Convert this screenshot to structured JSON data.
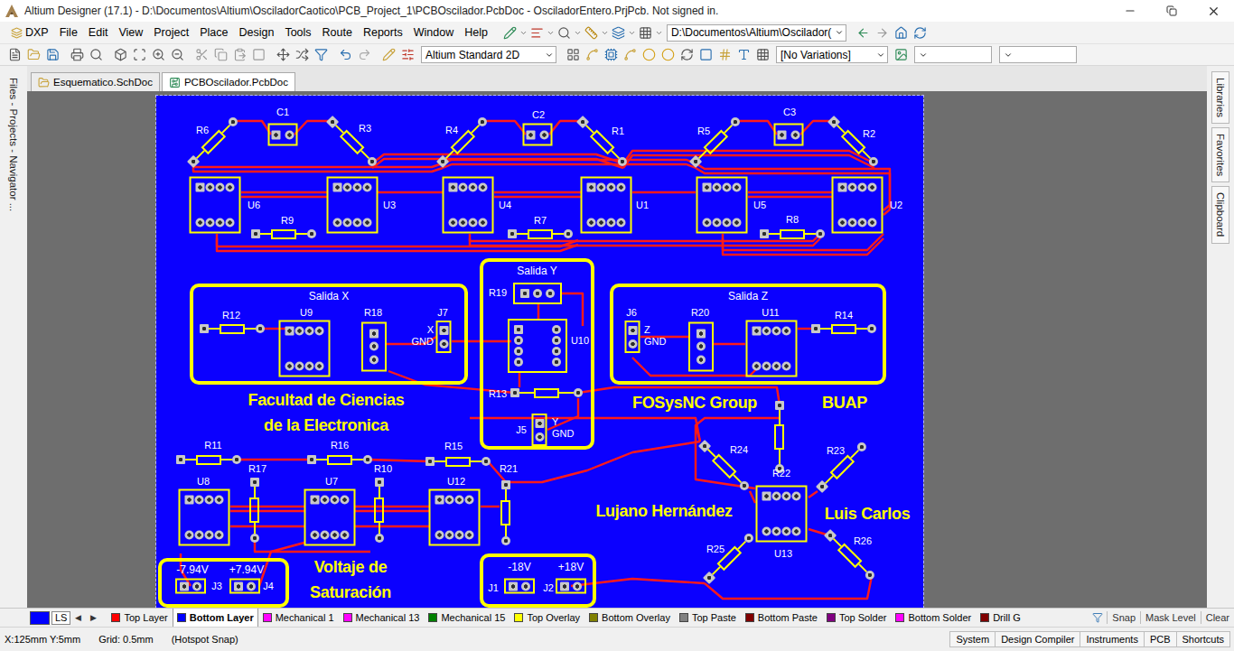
{
  "window": {
    "title": "Altium Designer (17.1) - D:\\Documentos\\Altium\\OsciladorCaotico\\PCB_Project_1\\PCBOscilador.PcbDoc - OsciladorEntero.PrjPcb. Not signed in."
  },
  "menu": [
    "DXP",
    "File",
    "Edit",
    "View",
    "Project",
    "Place",
    "Design",
    "Tools",
    "Route",
    "Reports",
    "Window",
    "Help"
  ],
  "toolbar": {
    "path": "D:\\Documentos\\Altium\\Oscilador(",
    "view_mode": "Altium Standard 2D",
    "variations": "[No Variations]"
  },
  "side_panels": {
    "left": [
      "Files - Projects - Navigator ..."
    ],
    "right": [
      "Libraries",
      "Favorites",
      "Clipboard"
    ]
  },
  "documents": [
    {
      "label": "Esquematico.SchDoc",
      "kind": "schematic",
      "selected": false
    },
    {
      "label": "PCBOscilador.PcbDoc",
      "kind": "pcb",
      "selected": true
    }
  ],
  "board": {
    "sections": [
      {
        "kind": "titled",
        "title": "Salida X"
      },
      {
        "kind": "titled",
        "title": "Salida Y"
      },
      {
        "kind": "titled",
        "title": "Salida Z"
      },
      {
        "kind": "frame"
      },
      {
        "kind": "frame"
      }
    ],
    "texts": [
      {
        "text": "Facultad de Ciencias",
        "kind": "title"
      },
      {
        "text": "de la Electronica",
        "kind": "title"
      },
      {
        "text": "FOSysNC Group",
        "kind": "title"
      },
      {
        "text": "BUAP",
        "kind": "title"
      },
      {
        "text": "Lujano Hernández",
        "kind": "title"
      },
      {
        "text": "Luis Carlos",
        "kind": "title"
      },
      {
        "text": "Voltaje de",
        "kind": "title"
      },
      {
        "text": "Saturación",
        "kind": "title"
      },
      {
        "text": "-7.94V",
        "kind": "note"
      },
      {
        "text": "+7.94V",
        "kind": "note"
      },
      {
        "text": "-18V",
        "kind": "note"
      },
      {
        "text": "+18V",
        "kind": "note"
      }
    ],
    "components": [
      {
        "designator": "R6",
        "kind": "resistor"
      },
      {
        "designator": "C1",
        "kind": "capacitor"
      },
      {
        "designator": "R3",
        "kind": "resistor"
      },
      {
        "designator": "R4",
        "kind": "resistor"
      },
      {
        "designator": "C2",
        "kind": "capacitor"
      },
      {
        "designator": "R1",
        "kind": "resistor"
      },
      {
        "designator": "R5",
        "kind": "resistor"
      },
      {
        "designator": "C3",
        "kind": "capacitor"
      },
      {
        "designator": "R2",
        "kind": "resistor"
      },
      {
        "designator": "U6",
        "kind": "ic"
      },
      {
        "designator": "U3",
        "kind": "ic"
      },
      {
        "designator": "U4",
        "kind": "ic"
      },
      {
        "designator": "U1",
        "kind": "ic"
      },
      {
        "designator": "U5",
        "kind": "ic"
      },
      {
        "designator": "U2",
        "kind": "ic"
      },
      {
        "designator": "R9",
        "kind": "resistor"
      },
      {
        "designator": "R7",
        "kind": "resistor"
      },
      {
        "designator": "R8",
        "kind": "resistor"
      },
      {
        "designator": "R12",
        "kind": "resistor"
      },
      {
        "designator": "U9",
        "kind": "ic"
      },
      {
        "designator": "R18",
        "kind": "pot"
      },
      {
        "designator": "J7",
        "kind": "connector",
        "pins": [
          "X",
          "GND"
        ]
      },
      {
        "designator": "R19",
        "kind": "pot"
      },
      {
        "designator": "U10",
        "kind": "ic"
      },
      {
        "designator": "R13",
        "kind": "resistor"
      },
      {
        "designator": "J5",
        "kind": "connector",
        "pins": [
          "Y",
          "GND"
        ]
      },
      {
        "designator": "J6",
        "kind": "connector",
        "pins": [
          "Z",
          "GND"
        ]
      },
      {
        "designator": "R20",
        "kind": "pot"
      },
      {
        "designator": "U11",
        "kind": "ic"
      },
      {
        "designator": "R14",
        "kind": "resistor"
      },
      {
        "designator": "R11",
        "kind": "resistor"
      },
      {
        "designator": "R16",
        "kind": "resistor"
      },
      {
        "designator": "R15",
        "kind": "resistor"
      },
      {
        "designator": "R21",
        "kind": "resistor"
      },
      {
        "designator": "U8",
        "kind": "ic"
      },
      {
        "designator": "R17",
        "kind": "resistor"
      },
      {
        "designator": "U7",
        "kind": "ic"
      },
      {
        "designator": "R10",
        "kind": "resistor"
      },
      {
        "designator": "U12",
        "kind": "ic"
      },
      {
        "designator": "R22",
        "kind": "resistor"
      },
      {
        "designator": "R24",
        "kind": "resistor"
      },
      {
        "designator": "R23",
        "kind": "resistor"
      },
      {
        "designator": "U13",
        "kind": "ic"
      },
      {
        "designator": "R25",
        "kind": "resistor"
      },
      {
        "designator": "R26",
        "kind": "resistor"
      },
      {
        "designator": "J3",
        "kind": "connector"
      },
      {
        "designator": "J4",
        "kind": "connector"
      },
      {
        "designator": "J1",
        "kind": "connector"
      },
      {
        "designator": "J2",
        "kind": "connector"
      }
    ]
  },
  "layers": {
    "current": {
      "label": "LS",
      "color": "#0000ff"
    },
    "nav": [
      "◀",
      "▶"
    ],
    "tabs": [
      {
        "label": "Top Layer",
        "color": "#ff0000",
        "selected": false
      },
      {
        "label": "Bottom Layer",
        "color": "#0000ff",
        "selected": true
      },
      {
        "label": "Mechanical 1",
        "color": "#ff00ff",
        "selected": false
      },
      {
        "label": "Mechanical 13",
        "color": "#ff00ff",
        "selected": false
      },
      {
        "label": "Mechanical 15",
        "color": "#008000",
        "selected": false
      },
      {
        "label": "Top Overlay",
        "color": "#ffff00",
        "selected": false
      },
      {
        "label": "Bottom Overlay",
        "color": "#808000",
        "selected": false
      },
      {
        "label": "Top Paste",
        "color": "#808080",
        "selected": false
      },
      {
        "label": "Bottom Paste",
        "color": "#800000",
        "selected": false
      },
      {
        "label": "Top Solder",
        "color": "#800080",
        "selected": false
      },
      {
        "label": "Bottom Solder",
        "color": "#ff00ff",
        "selected": false
      },
      {
        "label": "Drill G",
        "color": "#800000",
        "selected": false
      }
    ],
    "buttons": [
      "Snap",
      "Mask Level",
      "Clear"
    ]
  },
  "status_bar": {
    "items": [
      "X:125mm Y:5mm",
      "Grid: 0.5mm",
      "(Hotspot Snap)"
    ],
    "buttons": [
      "System",
      "Design Compiler",
      "Instruments",
      "PCB",
      "Shortcuts"
    ]
  }
}
